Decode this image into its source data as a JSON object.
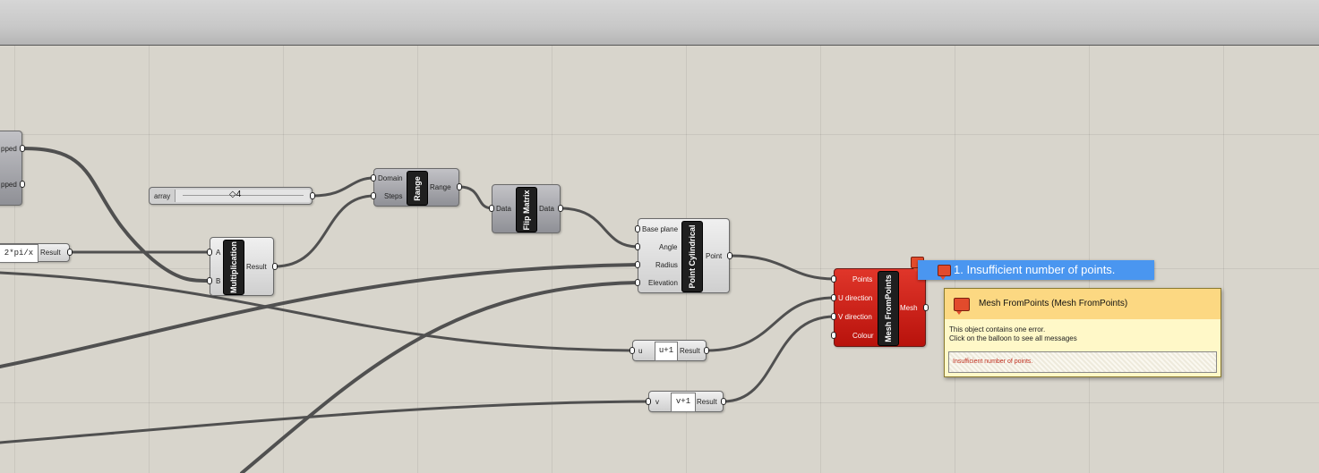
{
  "slider": {
    "label": "array",
    "value": "◇4"
  },
  "left_node": {
    "out1": "pped",
    "out2": "pped"
  },
  "expr1": {
    "expression": "2*pi/x",
    "output": "Result"
  },
  "multiplication": {
    "in_a": "A",
    "in_b": "B",
    "name": "Multiplication",
    "output": "Result"
  },
  "range": {
    "in_domain": "Domain",
    "in_steps": "Steps",
    "name": "Range",
    "output": "Range"
  },
  "flip_matrix": {
    "input": "Data",
    "name": "Flip Matrix",
    "output": "Data"
  },
  "point_cyl": {
    "in_base": "Base plane",
    "in_angle": "Angle",
    "in_radius": "Radius",
    "in_elev": "Elevation",
    "name": "Point Cylindrical",
    "output": "Point"
  },
  "expr_u": {
    "input": "u",
    "expression": "u+1",
    "output": "Result"
  },
  "expr_v": {
    "input": "v",
    "expression": "v+1",
    "output": "Result"
  },
  "mesh": {
    "in_points": "Points",
    "in_u": "U direction",
    "in_v": "V direction",
    "in_colour": "Colour",
    "name": "Mesh FromPoints",
    "output": "Mesh"
  },
  "error_bar": {
    "text": "1. Insufficient number of points."
  },
  "info": {
    "title": "Mesh FromPoints (Mesh FromPoints)",
    "line1": "This object contains one error.",
    "line2": "Click on the balloon to see all messages",
    "message": "Insufficient number of points."
  },
  "colors": {
    "error": "#c81a10",
    "tooltip": "#4a96f0",
    "canvas": "#d8d5cc"
  }
}
